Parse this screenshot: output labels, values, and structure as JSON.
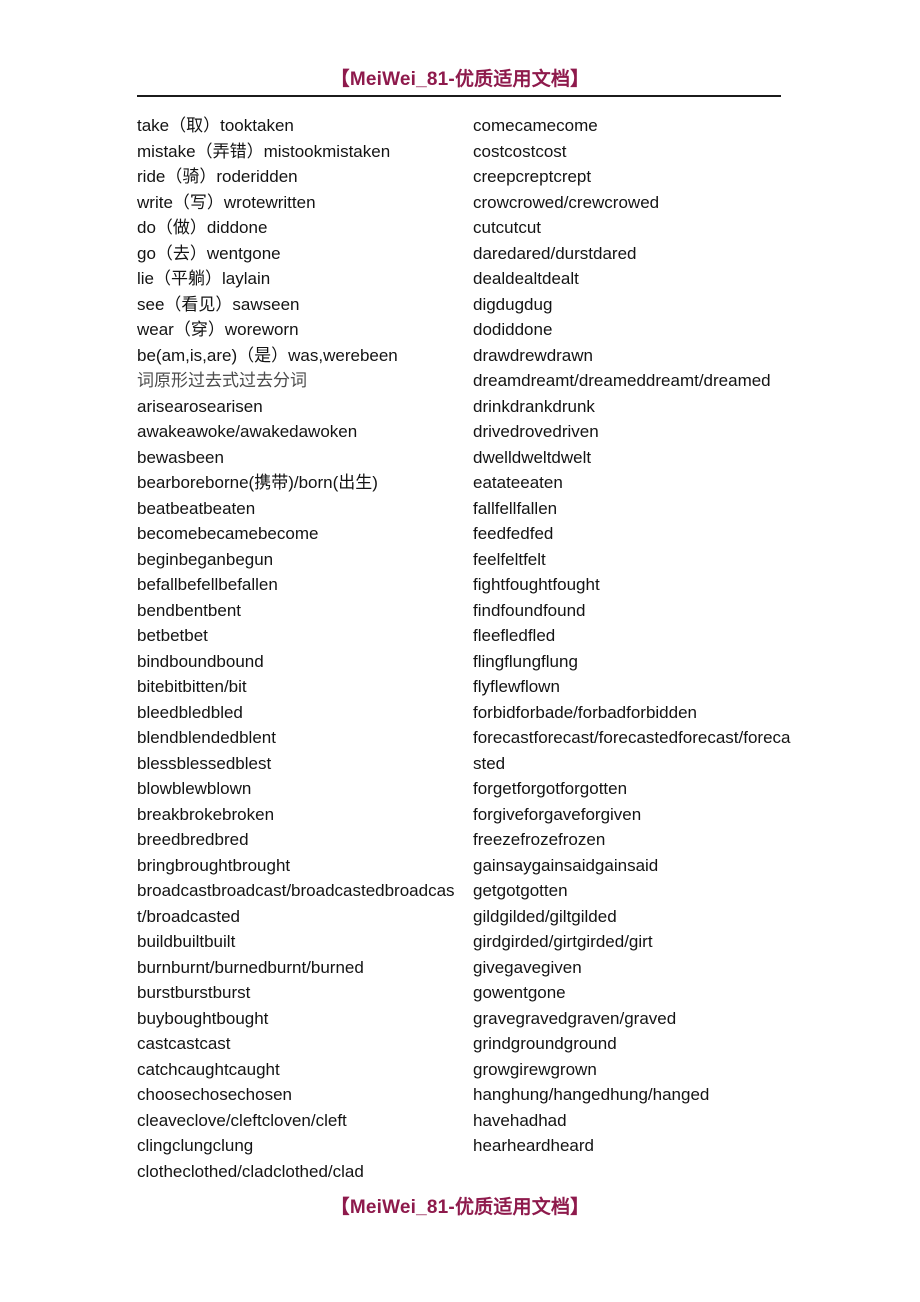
{
  "header": {
    "watermark": "【MeiWei_81-优质适用文档】"
  },
  "footer": {
    "watermark": "【MeiWei_81-优质适用文档】"
  },
  "theme": {
    "watermark_color": "#8E1A4C",
    "rule_color": "#1B1B1B",
    "text_color": "#131313",
    "note_color": "#4B4B4B",
    "background": "#FFFFFF"
  },
  "columns": {
    "left": [
      {
        "text": "take（取）tooktaken",
        "style": "normal"
      },
      {
        "text": "mistake（弄错）mistookmistaken",
        "style": "normal"
      },
      {
        "text": "ride（骑）roderidden",
        "style": "normal"
      },
      {
        "text": "write（写）wrotewritten",
        "style": "normal"
      },
      {
        "text": "do（做）diddone",
        "style": "normal"
      },
      {
        "text": "go（去）wentgone",
        "style": "normal"
      },
      {
        "text": "lie（平躺）laylain",
        "style": "normal"
      },
      {
        "text": "see（看见）sawseen",
        "style": "normal"
      },
      {
        "text": "wear（穿）woreworn",
        "style": "normal"
      },
      {
        "text": "be(am,is,are)（是）was,werebeen",
        "style": "normal"
      },
      {
        "text": "词原形过去式过去分词",
        "style": "cjk-note"
      },
      {
        "text": "arisearosearisen",
        "style": "normal"
      },
      {
        "text": "awakeawoke/awakedawoken",
        "style": "normal"
      },
      {
        "text": "bewasbeen",
        "style": "normal"
      },
      {
        "text": "bearboreborne(携带)/born(出生)",
        "style": "normal"
      },
      {
        "text": "beatbeatbeaten",
        "style": "normal"
      },
      {
        "text": "becomebecamebecome",
        "style": "normal"
      },
      {
        "text": "beginbeganbegun",
        "style": "normal"
      },
      {
        "text": "befallbefellbefallen",
        "style": "normal"
      },
      {
        "text": "bendbentbent",
        "style": "normal"
      },
      {
        "text": "betbetbet",
        "style": "normal"
      },
      {
        "text": "bindboundbound",
        "style": "normal"
      },
      {
        "text": "bitebitbitten/bit",
        "style": "normal"
      },
      {
        "text": "bleedbledbled",
        "style": "normal"
      },
      {
        "text": "blendblendedblent",
        "style": "normal"
      },
      {
        "text": "blessblessedblest",
        "style": "normal"
      },
      {
        "text": "blowblewblown",
        "style": "normal"
      },
      {
        "text": "breakbrokebroken",
        "style": "normal"
      },
      {
        "text": "breedbredbred",
        "style": "normal"
      },
      {
        "text": "bringbroughtbrought",
        "style": "normal"
      },
      {
        "text": "broadcastbroadcast/broadcastedbroadcast/broadcasted",
        "style": "wrap"
      },
      {
        "text": "buildbuiltbuilt",
        "style": "normal"
      },
      {
        "text": "burnburnt/burnedburnt/burned",
        "style": "normal"
      },
      {
        "text": "burstburstburst",
        "style": "normal"
      },
      {
        "text": "buyboughtbought",
        "style": "normal"
      },
      {
        "text": "castcastcast",
        "style": "normal"
      },
      {
        "text": "catchcaughtcaught",
        "style": "normal"
      },
      {
        "text": "choosechosechosen",
        "style": "normal"
      },
      {
        "text": "cleaveclove/cleftcloven/cleft",
        "style": "normal"
      },
      {
        "text": "clingclungclung",
        "style": "normal"
      },
      {
        "text": "clotheclothed/cladclothed/clad",
        "style": "normal"
      }
    ],
    "right": [
      {
        "text": "comecamecome",
        "style": "normal"
      },
      {
        "text": "costcostcost",
        "style": "normal"
      },
      {
        "text": "creepcreptcrept",
        "style": "normal"
      },
      {
        "text": "crowcrowed/crewcrowed",
        "style": "normal"
      },
      {
        "text": "cutcutcut",
        "style": "normal"
      },
      {
        "text": "daredared/durstdared",
        "style": "normal"
      },
      {
        "text": "dealdealtdealt",
        "style": "normal"
      },
      {
        "text": "digdugdug",
        "style": "normal"
      },
      {
        "text": "dodiddone",
        "style": "normal"
      },
      {
        "text": "drawdrewdrawn",
        "style": "normal"
      },
      {
        "text": "dreamdreamt/dreameddreamt/dreamed",
        "style": "wrap"
      },
      {
        "text": "drinkdrankdrunk",
        "style": "normal"
      },
      {
        "text": "drivedrovedriven",
        "style": "normal"
      },
      {
        "text": "dwelldweltdwelt",
        "style": "normal"
      },
      {
        "text": "eatateeaten",
        "style": "normal"
      },
      {
        "text": "fallfellfallen",
        "style": "normal"
      },
      {
        "text": "feedfedfed",
        "style": "normal"
      },
      {
        "text": "feelfeltfelt",
        "style": "normal"
      },
      {
        "text": "fightfoughtfought",
        "style": "normal"
      },
      {
        "text": "findfoundfound",
        "style": "normal"
      },
      {
        "text": "fleefledfled",
        "style": "normal"
      },
      {
        "text": "flingflungflung",
        "style": "normal"
      },
      {
        "text": "flyflewflown",
        "style": "normal"
      },
      {
        "text": "forbidforbade/forbadforbidden",
        "style": "normal"
      },
      {
        "text": "forecastforecast/forecastedforecast/forecasted",
        "style": "wrap"
      },
      {
        "text": "forgetforgotforgotten",
        "style": "normal"
      },
      {
        "text": "forgiveforgaveforgiven",
        "style": "normal"
      },
      {
        "text": "freezefrozefrozen",
        "style": "normal"
      },
      {
        "text": "gainsaygainsaidgainsaid",
        "style": "normal"
      },
      {
        "text": "getgotgotten",
        "style": "normal"
      },
      {
        "text": "gildgilded/giltgilded",
        "style": "normal"
      },
      {
        "text": "girdgirded/girtgirded/girt",
        "style": "normal"
      },
      {
        "text": "givegavegiven",
        "style": "normal"
      },
      {
        "text": "gowentgone",
        "style": "normal"
      },
      {
        "text": "gravegravedgraven/graved",
        "style": "normal"
      },
      {
        "text": "grindgroundground",
        "style": "normal"
      },
      {
        "text": "growgirewgrown",
        "style": "normal"
      },
      {
        "text": "hanghung/hangedhung/hanged",
        "style": "normal"
      },
      {
        "text": "havehadhad",
        "style": "normal"
      },
      {
        "text": "hearheardheard",
        "style": "normal"
      }
    ]
  }
}
